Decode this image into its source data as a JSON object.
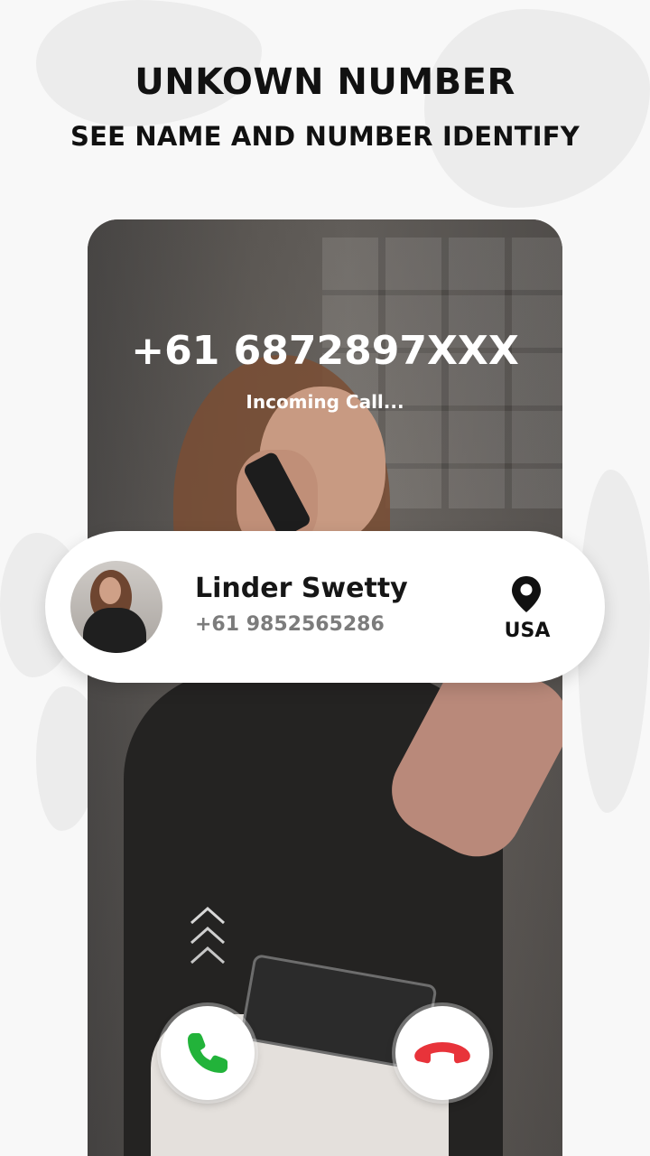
{
  "header": {
    "title": "UNKOWN NUMBER",
    "subtitle": "SEE NAME AND NUMBER IDENTIFY"
  },
  "incoming_call": {
    "number": "+61 6872897XXX",
    "status": "Incoming Call..."
  },
  "caller_card": {
    "name": "Linder Swetty",
    "number": "+61 9852565286",
    "location_icon": "location-pin-icon",
    "country": "USA"
  },
  "actions": {
    "swipe_icon": "chevron-up-icon",
    "accept_icon": "phone-icon",
    "decline_icon": "phone-hangup-icon"
  },
  "colors": {
    "accept": "#22b33a",
    "decline": "#e8333a",
    "text_dark": "#111111",
    "text_muted": "#7c7c7c"
  }
}
